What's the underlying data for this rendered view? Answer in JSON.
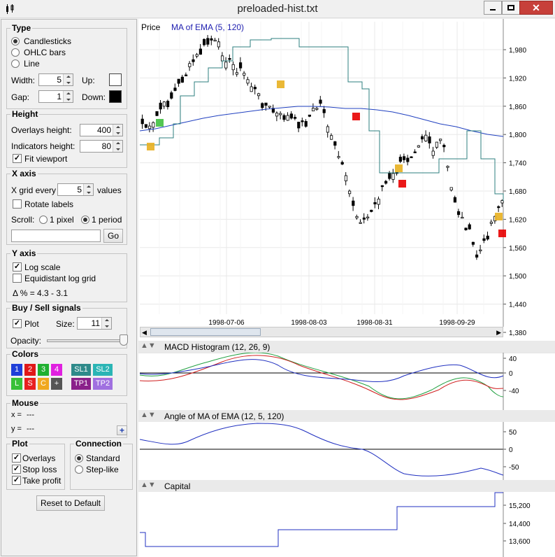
{
  "window": {
    "title": "preloaded-hist.txt",
    "close": "✕"
  },
  "sidebar": {
    "type": {
      "title": "Type",
      "options": [
        "Candlesticks",
        "OHLC bars",
        "Line"
      ],
      "selected": "Candlesticks",
      "width_label": "Width:",
      "width": "5",
      "up_label": "Up:",
      "gap_label": "Gap:",
      "gap": "1",
      "down_label": "Down:"
    },
    "height": {
      "title": "Height",
      "overlays_label": "Overlays height:",
      "overlays": "400",
      "indicators_label": "Indicators height:",
      "indicators": "80",
      "fit_label": "Fit viewport",
      "fit": true
    },
    "xaxis": {
      "title": "X axis",
      "grid_label": "X grid every",
      "grid": "5",
      "values_label": "values",
      "rotate_label": "Rotate labels",
      "rotate": false,
      "scroll_label": "Scroll:",
      "pixel_label": "1 pixel",
      "period_label": "1 period",
      "scroll_selected": "1 period",
      "go_label": "Go"
    },
    "yaxis": {
      "title": "Y axis",
      "log_label": "Log scale",
      "log": true,
      "equi_label": "Equidistant log grid",
      "equi": false,
      "delta": "Δ % = 4.3 - 3.1"
    },
    "signals": {
      "title": "Buy / Sell signals",
      "plot_label": "Plot",
      "plot": true,
      "size_label": "Size:",
      "size": "11",
      "opacity_label": "Opacity:"
    },
    "colors": {
      "title": "Colors",
      "boxes": [
        {
          "label": "1",
          "color": "#1f3fd8"
        },
        {
          "label": "2",
          "color": "#e01818"
        },
        {
          "label": "3",
          "color": "#20b030"
        },
        {
          "label": "4",
          "color": "#e020e0"
        },
        {
          "label": "SL1",
          "color": "#2e8a8a"
        },
        {
          "label": "SL2",
          "color": "#2bb5b5"
        },
        {
          "label": "L",
          "color": "#38c038"
        },
        {
          "label": "S",
          "color": "#e82020"
        },
        {
          "label": "C",
          "color": "#f0a820"
        },
        {
          "label": "+",
          "color": "#555555"
        },
        {
          "label": "TP1",
          "color": "#8a208a"
        },
        {
          "label": "TP2",
          "color": "#a070e0"
        }
      ]
    },
    "mouse": {
      "title": "Mouse",
      "x_label": "x =",
      "x": "---",
      "y_label": "y =",
      "y": "---"
    },
    "plot": {
      "title": "Plot",
      "overlays_label": "Overlays",
      "stoploss_label": "Stop loss",
      "takeprofit_label": "Take profit"
    },
    "connection": {
      "title": "Connection",
      "standard_label": "Standard",
      "step_label": "Step-like",
      "selected": "Standard"
    },
    "reset_label": "Reset to Default"
  },
  "chart": {
    "price_label": "Price",
    "overlay_label": "MA of EMA (5, 120)",
    "price_ticks": [
      "1,980",
      "1,920",
      "1,860",
      "1,800",
      "1,740",
      "1,680",
      "1,620",
      "1,560",
      "1,500",
      "1,440",
      "1,380"
    ],
    "date_ticks": [
      "1998-07-06",
      "1998-08-03",
      "1998-08-31",
      "1998-09-29"
    ],
    "macd": {
      "title": "MACD Histogram (12, 26, 9)",
      "ticks": [
        "40",
        "0",
        "-40"
      ]
    },
    "angle": {
      "title": "Angle of MA of EMA (12, 5, 120)",
      "ticks": [
        "50",
        "0",
        "-50"
      ]
    },
    "capital": {
      "title": "Capital",
      "ticks": [
        "15,200",
        "14,400",
        "13,600"
      ]
    },
    "colors": {
      "ma": "#2040c0",
      "stop": "#2e7f7f",
      "buy": "#e8b020",
      "sell": "#e80000",
      "long": "#40c040"
    }
  }
}
